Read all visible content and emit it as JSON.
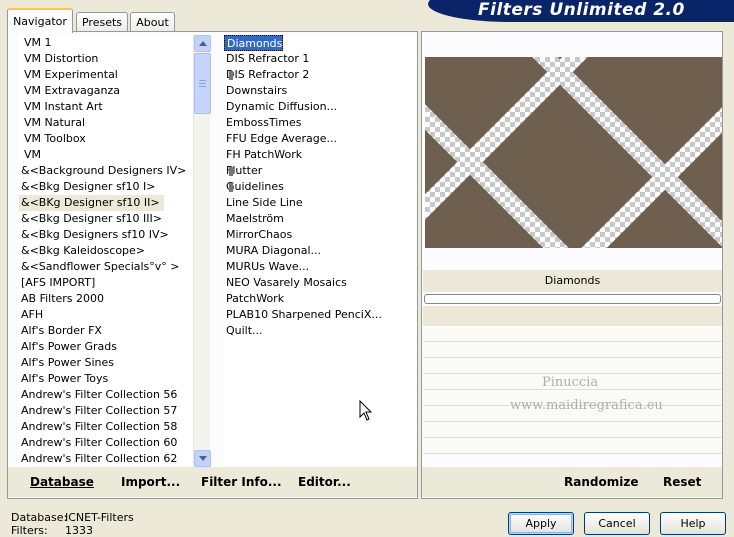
{
  "header": {
    "title": "Filters Unlimited 2.0"
  },
  "tabs": [
    {
      "label": "Navigator",
      "active": true
    },
    {
      "label": "Presets",
      "active": false
    },
    {
      "label": "About",
      "active": false
    }
  ],
  "categories": [
    "VM 1",
    "VM Distortion",
    "VM Experimental",
    "VM Extravaganza",
    "VM Instant Art",
    "VM Natural",
    "VM Toolbox",
    "VM",
    "&<Background Designers IV>",
    "&<Bkg Designer sf10 I>",
    "&<BKg Designer sf10 II>",
    "&<Bkg Designer sf10 III>",
    "&<Bkg Designers sf10 IV>",
    "&<Bkg Kaleidoscope>",
    "&<Sandflower Specials°v° >",
    "[AFS IMPORT]",
    "AB Filters 2000",
    "AFH",
    "Alf's Border FX",
    "Alf's Power Grads",
    "Alf's Power Sines",
    "Alf's Power Toys",
    "Andrew's Filter Collection 56",
    "Andrew's Filter Collection 57",
    "Andrew's Filter Collection 58",
    "Andrew's Filter Collection 60",
    "Andrew's Filter Collection 62"
  ],
  "selected_category": "&<BKg Designer sf10 II>",
  "filters": [
    "Diamonds",
    "DIS Refractor 1",
    "DIS Refractor 2",
    "Downstairs",
    "Dynamic Diffusion...",
    "EmbossTimes",
    "FFU Edge Average...",
    "FH PatchWork",
    "Flutter",
    "Guidelines",
    "Line Side Line",
    "Maelström",
    "MirrorChaos",
    "MURA Diagonal...",
    "MURUs Wave...",
    "NEO Vasarely Mosaics",
    "PatchWork",
    "PLAB10 Sharpened PenciX...",
    "Quilt..."
  ],
  "selected_filter": "Diamonds",
  "left_buttons": {
    "database": "Database",
    "import": "Import...",
    "filter_info": "Filter Info...",
    "editor": "Editor..."
  },
  "preview": {
    "filter_name": "Diamonds"
  },
  "right_buttons": {
    "randomize": "Randomize",
    "reset": "Reset"
  },
  "watermark": {
    "line1": "Pinuccia",
    "line2": "www.maidiregrafica.eu"
  },
  "info": {
    "database_label": "Database:",
    "database_value": "ICNET-Filters",
    "filters_label": "Filters:",
    "filters_value": "1333"
  },
  "dialog_buttons": {
    "apply": "Apply",
    "cancel": "Cancel",
    "help": "Help"
  },
  "colors": {
    "preview_brown": "#6f5f4f",
    "selection_blue": "#316ac5",
    "brand_blue": "#0a246a"
  }
}
